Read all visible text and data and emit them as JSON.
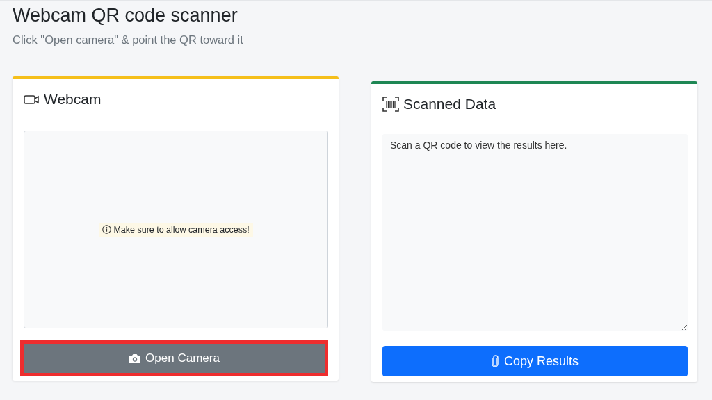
{
  "header": {
    "title": "Webcam QR code scanner",
    "subtitle": "Click \"Open camera\" & point the QR toward it"
  },
  "cards": [
    {
      "kind": "webcam",
      "title": "Webcam",
      "color": "#f5bf1b",
      "notice": "Make sure to allow camera access!",
      "button": {
        "label": "Open Camera",
        "highlighted": true
      }
    },
    {
      "kind": "results",
      "title": "Scanned Data",
      "color": "#1e8754",
      "placeholder": "Scan a QR code to view the results here.",
      "button": {
        "label": "Copy Results"
      }
    }
  ]
}
